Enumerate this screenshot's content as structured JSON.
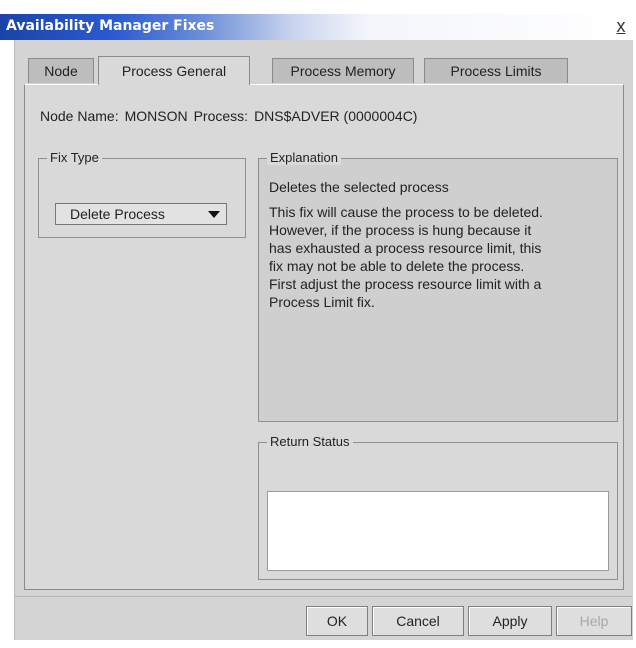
{
  "window": {
    "title": "Availability Manager Fixes",
    "close_glyph": "x",
    "close_icon": "close-icon"
  },
  "tabs": [
    {
      "label": "Node",
      "active": false
    },
    {
      "label": "Process General",
      "active": true
    },
    {
      "label": "Process Memory",
      "active": false
    },
    {
      "label": "Process Limits",
      "active": false
    }
  ],
  "node_info": {
    "node_label": "Node Name:",
    "node_value": "MONSON",
    "process_label": "Process:",
    "process_value": "DNS$ADVER (0000004C)"
  },
  "fix_type": {
    "label": "Fix Type",
    "selected": "Delete Process",
    "arrow_icon": "chevron-down-icon"
  },
  "explanation": {
    "label": "Explanation",
    "title": "Deletes the selected process",
    "body_lines": [
      "This fix will cause the process to be deleted.",
      "However, if the process is hung because it",
      "has exhausted a process resource limit, this",
      "fix may not be able to delete the process.",
      "First adjust the process resource limit with a",
      "Process Limit fix."
    ]
  },
  "return_status": {
    "label": "Return Status",
    "value": ""
  },
  "buttons": {
    "ok": "OK",
    "cancel": "Cancel",
    "apply": "Apply",
    "help": "Help"
  },
  "colors": {
    "title_bar": "#2a5bd0",
    "dialog_bg": "#d9d9d9",
    "disabled_text": "#a8a8a8"
  }
}
